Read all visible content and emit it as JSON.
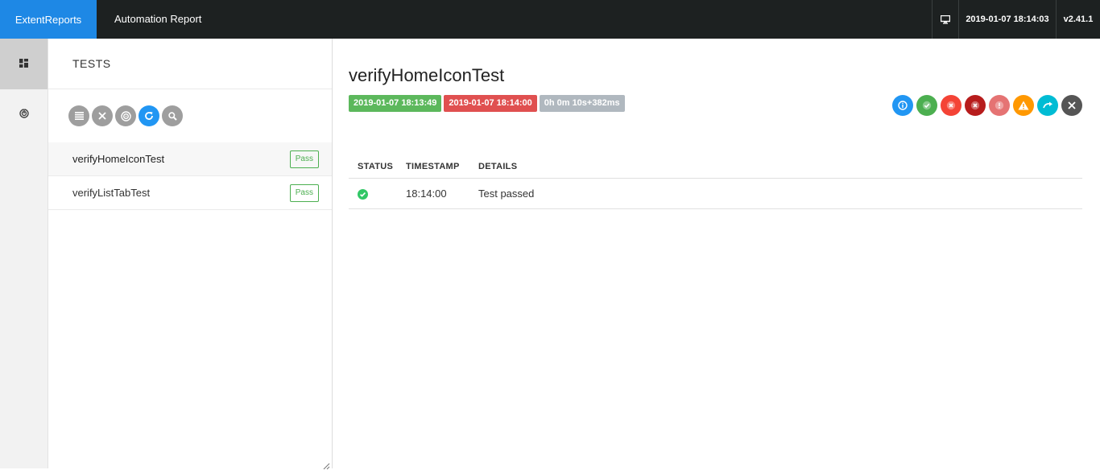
{
  "topbar": {
    "brand": "ExtentReports",
    "report_name": "Automation Report",
    "timestamp": "2019-01-07 18:14:03",
    "version": "v2.41.1"
  },
  "nav": {
    "items": [
      {
        "icon": "dashboard-icon"
      },
      {
        "icon": "analysis-icon"
      }
    ]
  },
  "tests_panel": {
    "header": "TESTS",
    "toolbar": [
      "list-icon",
      "close-icon",
      "radar-icon",
      "refresh-icon",
      "search-icon"
    ],
    "items": [
      {
        "name": "verifyHomeIconTest",
        "status": "Pass"
      },
      {
        "name": "verifyListTabTest",
        "status": "Pass"
      }
    ]
  },
  "detail": {
    "title": "verifyHomeIconTest",
    "start_time": "2019-01-07 18:13:49",
    "end_time": "2019-01-07 18:14:00",
    "duration": "0h 0m 10s+382ms",
    "status_filter_colors": [
      "#2196f3",
      "#4caf50",
      "#f44336",
      "#b71c1c",
      "#e57373",
      "#ff9800",
      "#00bcd4",
      "#555555"
    ],
    "log_table": {
      "headers": [
        "STATUS",
        "TIMESTAMP",
        "DETAILS"
      ],
      "rows": [
        {
          "status": "pass",
          "timestamp": "18:14:00",
          "details": "Test passed"
        }
      ]
    }
  }
}
